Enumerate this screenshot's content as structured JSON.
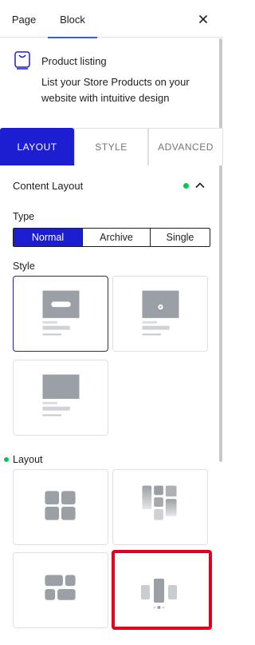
{
  "header": {
    "tabs": [
      {
        "label": "Page",
        "active": false
      },
      {
        "label": "Block",
        "active": true
      }
    ],
    "close_icon": "close-icon"
  },
  "block_card": {
    "icon": "product-listing-icon",
    "title": "Product listing",
    "description": "List your Store Products on your website with intuitive design"
  },
  "panel_tabs": [
    {
      "label": "LAYOUT",
      "active": true
    },
    {
      "label": "STYLE",
      "active": false
    },
    {
      "label": "ADVANCED",
      "active": false
    }
  ],
  "content_layout": {
    "title": "Content Layout",
    "modified": true,
    "expanded": true,
    "type": {
      "label": "Type",
      "options": [
        "Normal",
        "Archive",
        "Single"
      ],
      "selected": "Normal"
    },
    "style": {
      "label": "Style",
      "options": [
        "style-1",
        "style-2",
        "style-3"
      ],
      "selected": "style-1"
    },
    "layout": {
      "label": "Layout",
      "modified": true,
      "options": [
        "grid",
        "masonry",
        "alternate-grid",
        "slider"
      ],
      "highlighted": "slider"
    }
  },
  "colors": {
    "accent": "#1d1dd1",
    "modified_dot": "#00c853",
    "highlight": "#e3001b",
    "placeholder": "#9aa0a6"
  }
}
